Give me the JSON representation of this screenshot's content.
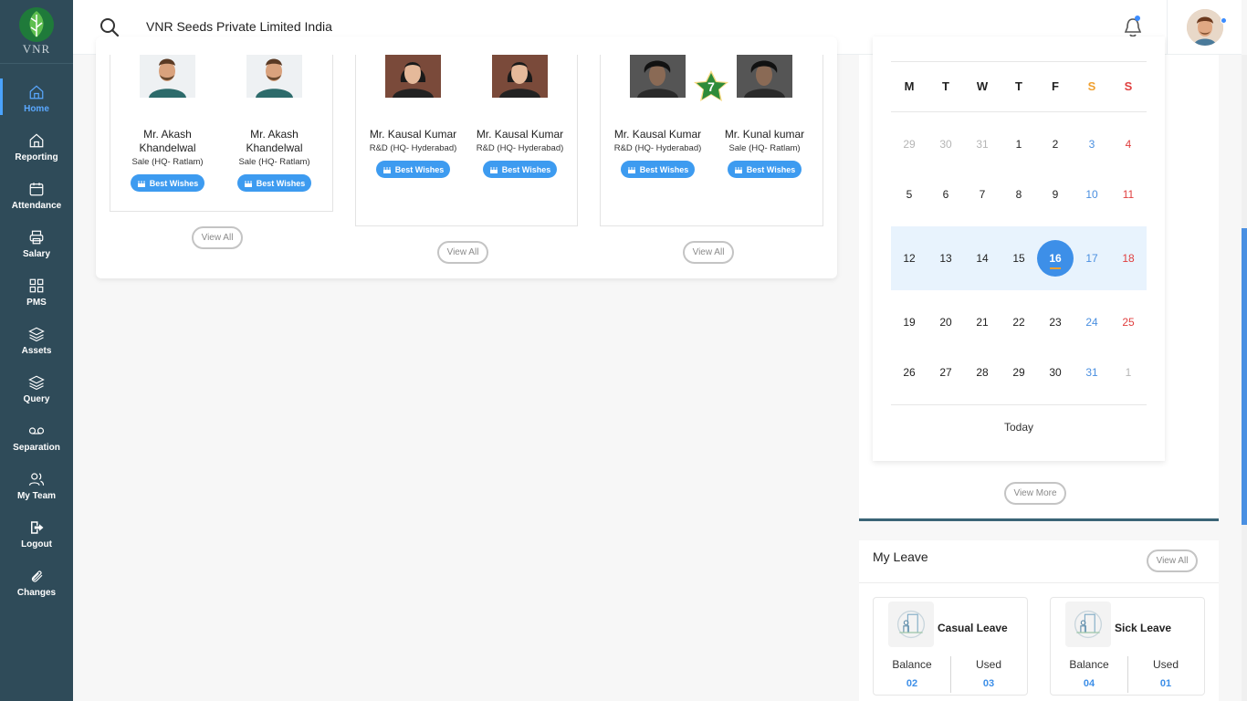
{
  "sidebar": {
    "brand": "VNR",
    "items": [
      {
        "label": "Home",
        "icon": "home-icon"
      },
      {
        "label": "Reporting",
        "icon": "home-icon"
      },
      {
        "label": "Attendance",
        "icon": "calendar-icon"
      },
      {
        "label": "Salary",
        "icon": "printer-icon"
      },
      {
        "label": "PMS",
        "icon": "grid-icon"
      },
      {
        "label": "Assets",
        "icon": "layers-icon"
      },
      {
        "label": "Query",
        "icon": "layers-icon"
      },
      {
        "label": "Separation",
        "icon": "voicemail-icon"
      },
      {
        "label": "My Team",
        "icon": "users-icon"
      },
      {
        "label": "Logout",
        "icon": "logout-icon"
      },
      {
        "label": "Changes",
        "icon": "paperclip-icon"
      }
    ]
  },
  "header": {
    "company": "VNR Seeds Private Limited India"
  },
  "wishes": {
    "button_label": "Best Wishes",
    "view_all_label": "View All",
    "groups": [
      {
        "people": [
          {
            "name": "Mr. Akash Khandelwal",
            "dept": "Sale (HQ- Ratlam)"
          },
          {
            "name": "Mr. Akash Khandelwal",
            "dept": "Sale (HQ- Ratlam)"
          }
        ]
      },
      {
        "people": [
          {
            "name": "Mr. Kausal Kumar",
            "dept": "R&D (HQ- Hyderabad)"
          },
          {
            "name": "Mr. Kausal Kumar",
            "dept": "R&D (HQ- Hyderabad)"
          }
        ]
      },
      {
        "anniversary_years": "7",
        "people": [
          {
            "name": "Mr. Kausal Kumar",
            "dept": "R&D (HQ- Hyderabad)"
          },
          {
            "name": "Mr. Kunal kumar",
            "dept": "Sale (HQ- Ratlam)"
          }
        ]
      }
    ]
  },
  "calendar": {
    "weekdays": [
      "M",
      "T",
      "W",
      "T",
      "F",
      "S",
      "S"
    ],
    "weeks": [
      [
        "29",
        "30",
        "31",
        "1",
        "2",
        "3",
        "4"
      ],
      [
        "5",
        "6",
        "7",
        "8",
        "9",
        "10",
        "11"
      ],
      [
        "12",
        "13",
        "14",
        "15",
        "16",
        "17",
        "18"
      ],
      [
        "19",
        "20",
        "21",
        "22",
        "23",
        "24",
        "25"
      ],
      [
        "26",
        "27",
        "28",
        "29",
        "30",
        "31",
        "1"
      ]
    ],
    "today": "16",
    "today_label": "Today",
    "view_more_label": "View More",
    "colors": {
      "accent": "#3d8fe8",
      "saturday": "#4a8fe0",
      "sunday": "#e04040"
    }
  },
  "leave": {
    "title": "My Leave",
    "view_all_label": "View All",
    "balance_label": "Balance",
    "used_label": "Used",
    "cards": [
      {
        "name": "Casual Leave",
        "balance": "02",
        "used": "03"
      },
      {
        "name": "Sick Leave",
        "balance": "04",
        "used": "01"
      }
    ]
  }
}
